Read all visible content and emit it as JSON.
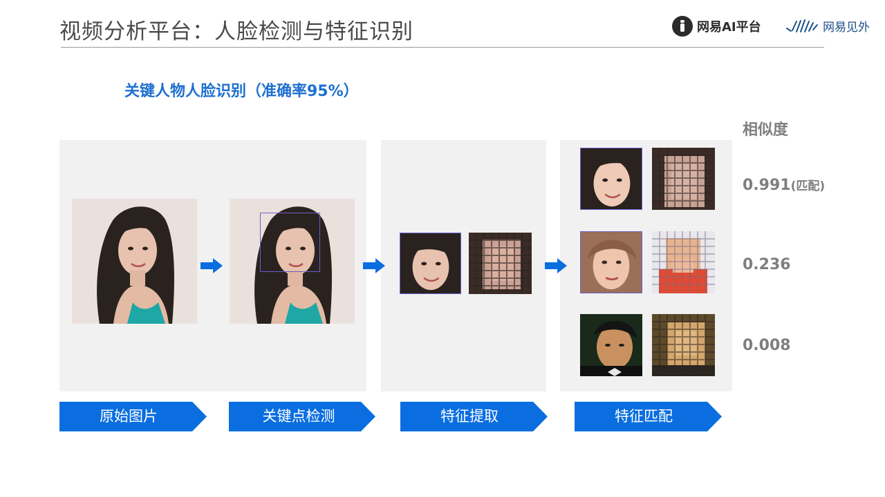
{
  "header": {
    "title": "视频分析平台：人脸检测与特征识别",
    "logo_ai_platform": "网易AI平台",
    "logo_jianwai": "网易见外"
  },
  "subtitle": "关键人物人脸识别（准确率95%）",
  "similarity": {
    "heading": "相似度",
    "rows": [
      {
        "value": "0.991",
        "note": "(匹配)"
      },
      {
        "value": "0.236",
        "note": ""
      },
      {
        "value": "0.008",
        "note": ""
      }
    ]
  },
  "steps": [
    {
      "label": "原始图片"
    },
    {
      "label": "关键点检测"
    },
    {
      "label": "特征提取"
    },
    {
      "label": "特征匹配"
    }
  ],
  "colors": {
    "accent": "#1E6FD0",
    "step_arrow": "#0A6EE0",
    "panel_bg": "#F1F1F1",
    "muted_text": "#7F7F7F"
  },
  "icons": {
    "flow_arrow": "right-arrow-icon",
    "logo_ai": "netease-ai-logo",
    "logo_jianwai": "netease-jianwai-wave-logo"
  }
}
